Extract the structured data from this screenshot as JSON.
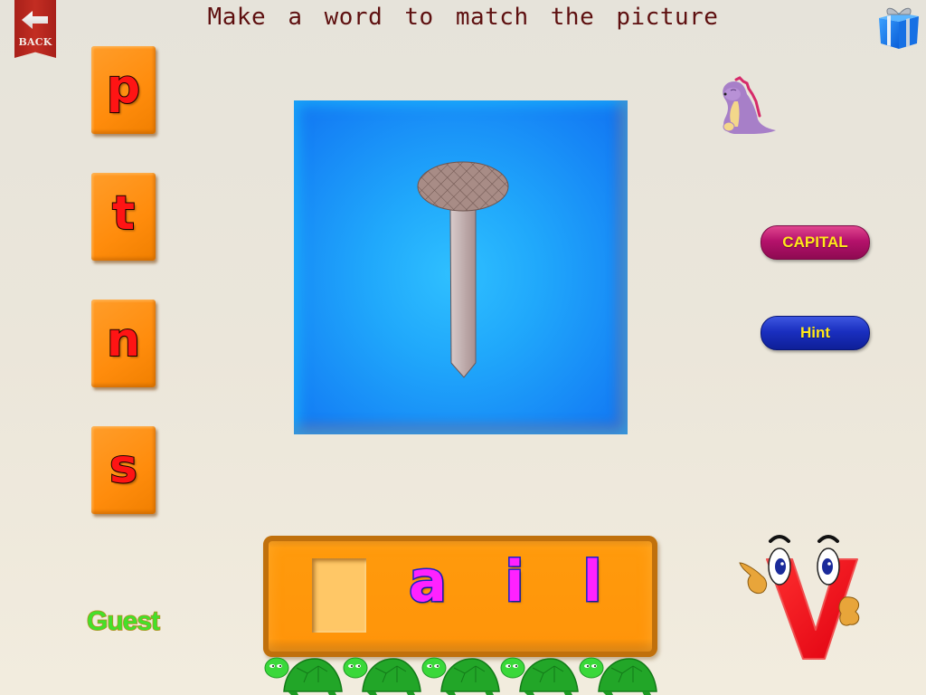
{
  "header": {
    "back_label": "BACK",
    "title": "Make a word to match the picture",
    "gift_icon": "gift-icon"
  },
  "letter_choices": [
    "p",
    "t",
    "n",
    "s"
  ],
  "picture": {
    "subject": "nail",
    "icon": "nail-picture"
  },
  "buttons": {
    "capital": "CAPITAL",
    "hint": "Hint"
  },
  "word": {
    "slots": [
      "",
      "a",
      "i",
      "l"
    ],
    "missing_index": 0
  },
  "user": {
    "name": "Guest"
  },
  "progress": {
    "turtles": 5
  },
  "colors": {
    "tile": "#ff8c0c",
    "tile_letter": "#ff1414",
    "word_letter": "#ff22ff",
    "word_letter_outline": "#1a22c8",
    "capital_button": "#b5126b",
    "hint_button": "#1a2fc0",
    "button_text": "#ffe81a",
    "title_text": "#5e1010",
    "guest_text": "#44e02a"
  }
}
